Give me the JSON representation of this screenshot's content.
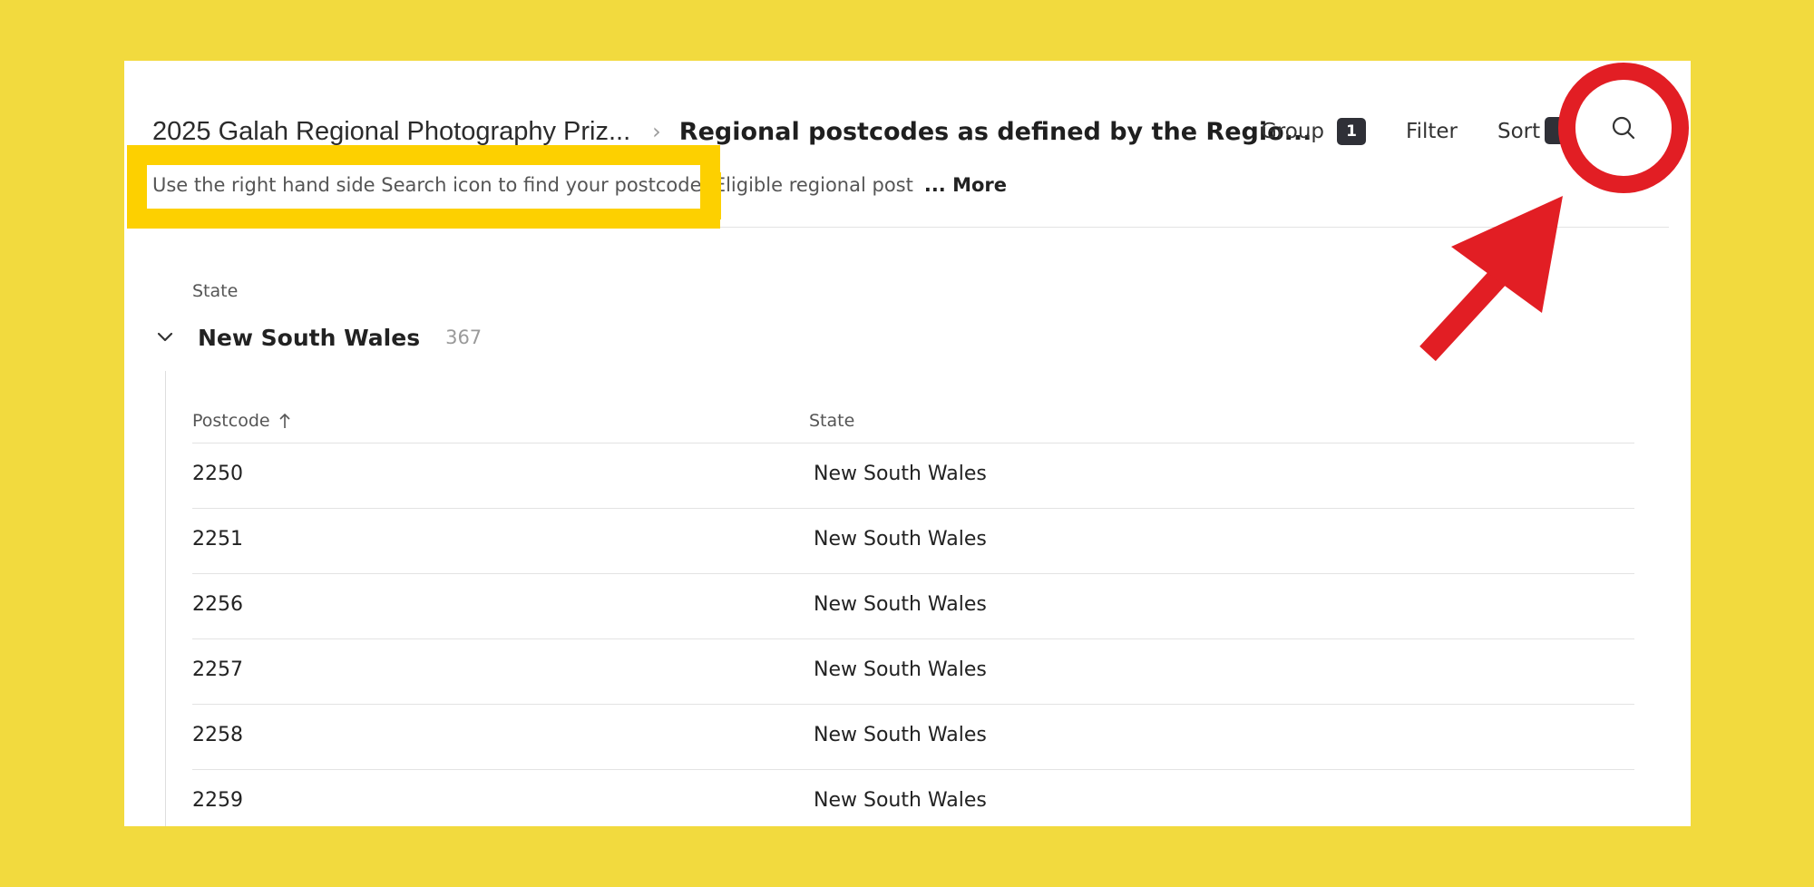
{
  "breadcrumb": {
    "parent": "2025 Galah Regional Photography Priz...",
    "separator": "›",
    "current": "Regional postcodes as defined by the Regio..."
  },
  "toolbar": {
    "group_label": "Group",
    "group_count": "1",
    "filter_label": "Filter",
    "sort_label": "Sort"
  },
  "description": {
    "text": "Use the right hand side Search icon to find your postcode. Eligible regional post",
    "more_label": "... More"
  },
  "group": {
    "field_label": "State",
    "name": "New South Wales",
    "count": "367"
  },
  "table": {
    "columns": [
      "Postcode",
      "State"
    ],
    "rows": [
      [
        "2250",
        "New South Wales"
      ],
      [
        "2251",
        "New South Wales"
      ],
      [
        "2256",
        "New South Wales"
      ],
      [
        "2257",
        "New South Wales"
      ],
      [
        "2258",
        "New South Wales"
      ],
      [
        "2259",
        "New South Wales"
      ]
    ]
  },
  "icons": {
    "search": "search-icon",
    "chevron": "chevron-down-icon",
    "sort": "arrow-up-icon"
  },
  "colors": {
    "background": "#f2da3e",
    "highlight": "#fdd000",
    "annotation_red": "#e21e24",
    "badge": "#2f3037"
  }
}
